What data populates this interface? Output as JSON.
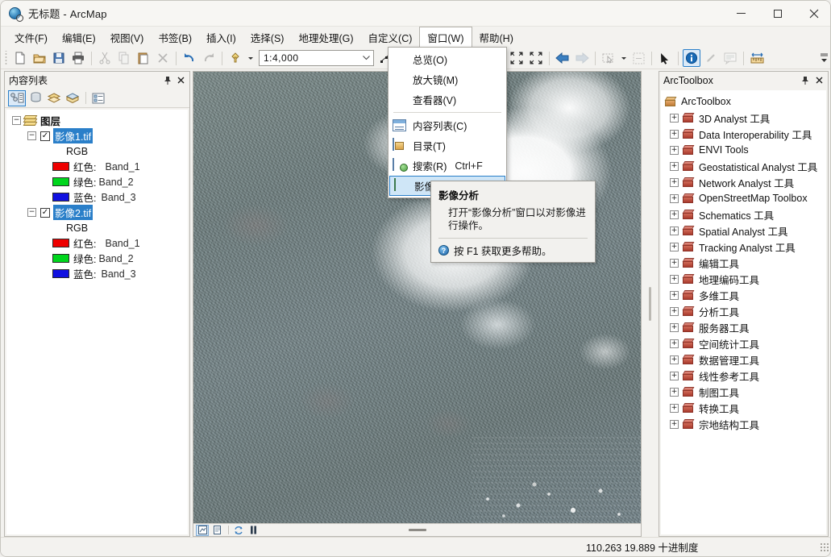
{
  "window": {
    "title": "无标题 - ArcMap",
    "icon": "arcmap-globe-icon",
    "minimize": "—",
    "maximize": "□",
    "close": "✕"
  },
  "menubar": {
    "items": [
      {
        "label": "文件(F)",
        "name": "menu-file"
      },
      {
        "label": "编辑(E)",
        "name": "menu-edit"
      },
      {
        "label": "视图(V)",
        "name": "menu-view"
      },
      {
        "label": "书签(B)",
        "name": "menu-bookmarks"
      },
      {
        "label": "插入(I)",
        "name": "menu-insert"
      },
      {
        "label": "选择(S)",
        "name": "menu-selection"
      },
      {
        "label": "地理处理(G)",
        "name": "menu-geoprocessing"
      },
      {
        "label": "自定义(C)",
        "name": "menu-customize"
      },
      {
        "label": "窗口(W)",
        "name": "menu-window",
        "open": true
      },
      {
        "label": "帮助(H)",
        "name": "menu-help"
      }
    ]
  },
  "toolbar": {
    "scale": {
      "value": "1:4,000",
      "arrow": "▼"
    },
    "buttons": [
      "new-document-icon",
      "open-document-icon",
      "save-icon",
      "print-icon",
      "cut-icon",
      "copy-icon",
      "paste-icon",
      "delete-icon",
      "undo-icon",
      "redo-icon",
      "add-data-icon",
      "editor-icon",
      "table-of-contents-icon",
      "zoom-in-icon",
      "zoom-out-icon",
      "pan-icon",
      "full-extent-icon",
      "fixed-zoom-in-icon",
      "fixed-zoom-out-icon",
      "previous-extent-icon",
      "next-extent-icon",
      "select-features-icon",
      "clear-selection-icon",
      "select-elements-icon",
      "identify-icon",
      "hyperlink-icon",
      "html-popup-icon",
      "measure-icon",
      "overflow-icon"
    ]
  },
  "window_menu": {
    "items": [
      {
        "label": "总览(O)",
        "shortcut": "",
        "icon": "",
        "name": "menu-overview"
      },
      {
        "label": "放大镜(M)",
        "shortcut": "",
        "icon": "",
        "name": "menu-magnifier"
      },
      {
        "label": "查看器(V)",
        "shortcut": "",
        "icon": "",
        "name": "menu-viewer"
      },
      {
        "separator": true
      },
      {
        "label": "内容列表(C)",
        "shortcut": "",
        "icon": "toc-icon",
        "name": "menu-table-of-contents"
      },
      {
        "label": "目录(T)",
        "shortcut": "",
        "icon": "catalog-icon",
        "name": "menu-catalog"
      },
      {
        "label": "搜索(R)",
        "shortcut": "Ctrl+F",
        "icon": "search-icon",
        "name": "menu-search"
      },
      {
        "label": "影像分析(I)",
        "shortcut": "",
        "icon": "image-analysis-icon",
        "name": "menu-image-analysis",
        "selected": true
      }
    ]
  },
  "tooltip": {
    "title": "影像分析",
    "body": "打开“影像分析”窗口以对影像进行操作。",
    "footer": "按 F1 获取更多帮助。",
    "help_icon": "help-circle-icon"
  },
  "toc": {
    "title": "内容列表",
    "pin": "⚲",
    "close": "✕",
    "toolbar_buttons": [
      "list-by-drawing-order-icon",
      "list-by-source-icon",
      "list-by-visibility-icon",
      "list-by-selection-icon",
      "options-icon"
    ],
    "root": {
      "label": "图层",
      "expander": "−",
      "icon": "layers-icon"
    },
    "layers": [
      {
        "name": "影像1.tif",
        "selected": true,
        "checked": true,
        "expander": "−",
        "renderer": "RGB",
        "bands": [
          {
            "channel": "红色:",
            "band": "Band_1",
            "color": "#ee0000"
          },
          {
            "channel": "绿色:",
            "band": "Band_2",
            "color": "#00d61d"
          },
          {
            "channel": "蓝色:",
            "band": "Band_3",
            "color": "#1010e0"
          }
        ]
      },
      {
        "name": "影像2.tif",
        "selected": true,
        "checked": true,
        "expander": "−",
        "renderer": "RGB",
        "bands": [
          {
            "channel": "红色:",
            "band": "Band_1",
            "color": "#ee0000"
          },
          {
            "channel": "绿色:",
            "band": "Band_2",
            "color": "#00d61d"
          },
          {
            "channel": "蓝色:",
            "band": "Band_3",
            "color": "#1010e0"
          }
        ]
      }
    ]
  },
  "map": {
    "statusbar_buttons": [
      "data-view-icon",
      "layout-view-icon",
      "refresh-icon",
      "pause-drawing-icon"
    ]
  },
  "arctoolbox": {
    "title": "ArcToolbox",
    "pin": "⚲",
    "close": "✕",
    "root": "ArcToolbox",
    "expander": "+",
    "items": [
      "3D Analyst 工具",
      "Data Interoperability 工具",
      "ENVI Tools",
      "Geostatistical Analyst 工具",
      "Network Analyst 工具",
      "OpenStreetMap Toolbox",
      "Schematics 工具",
      "Spatial Analyst 工具",
      "Tracking Analyst 工具",
      "编辑工具",
      "地理编码工具",
      "多维工具",
      "分析工具",
      "服务器工具",
      "空间统计工具",
      "数据管理工具",
      "线性参考工具",
      "制图工具",
      "转换工具",
      "宗地结构工具"
    ]
  },
  "statusbar": {
    "coordinates": "110.263  19.889  十进制度"
  },
  "colors": {
    "accent": "#2a7fc9",
    "selection": "#cfe6f7",
    "toolbox_red": "#c6594a",
    "panel_bg": "#f3f2ef"
  }
}
